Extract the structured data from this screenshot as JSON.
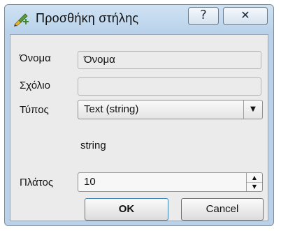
{
  "window": {
    "title": "Προσθήκη στήλης",
    "help_label": "?",
    "close_label": "✕",
    "icon": "add-column-pencil-icon"
  },
  "form": {
    "name_label": "Όνομα",
    "name_value": "Όνομα",
    "comment_label": "Σχόλιο",
    "comment_value": "",
    "type_label": "Τύπος",
    "type_value": "Text (string)",
    "type_hint": "string",
    "width_label": "Πλάτος",
    "width_value": "10"
  },
  "buttons": {
    "ok": "OK",
    "cancel": "Cancel"
  }
}
